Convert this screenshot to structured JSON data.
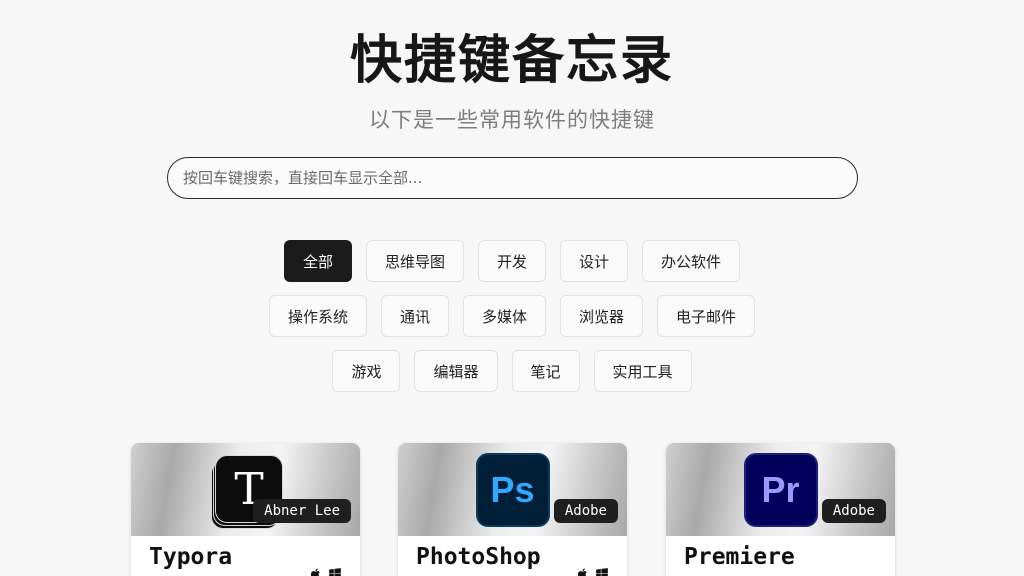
{
  "header": {
    "title": "快捷键备忘录",
    "subtitle": "以下是一些常用软件的快捷键"
  },
  "search": {
    "placeholder": "按回车键搜索，直接回车显示全部..."
  },
  "categories": {
    "row1": [
      "全部",
      "思维导图",
      "开发",
      "设计",
      "办公软件"
    ],
    "row2": [
      "操作系统",
      "通讯",
      "多媒体",
      "浏览器",
      "电子邮件"
    ],
    "row3": [
      "游戏",
      "编辑器",
      "笔记",
      "实用工具"
    ],
    "active": "全部"
  },
  "cards": [
    {
      "name": "Typora",
      "author": "Abner Lee",
      "icon_text": "T",
      "icon": "typora-icon",
      "platforms": [
        "apple-icon",
        "windows-icon"
      ]
    },
    {
      "name": "PhotoShop",
      "author": "Adobe",
      "icon_text": "Ps",
      "icon": "photoshop-icon",
      "icon_bg": "#001e36",
      "icon_fg": "#31a8ff",
      "platforms": [
        "apple-icon",
        "windows-icon"
      ]
    },
    {
      "name": "Premiere",
      "author": "Adobe",
      "icon_text": "Pr",
      "icon": "premiere-icon",
      "icon_bg": "#00005b",
      "icon_fg": "#9999ff",
      "platforms": []
    }
  ]
}
